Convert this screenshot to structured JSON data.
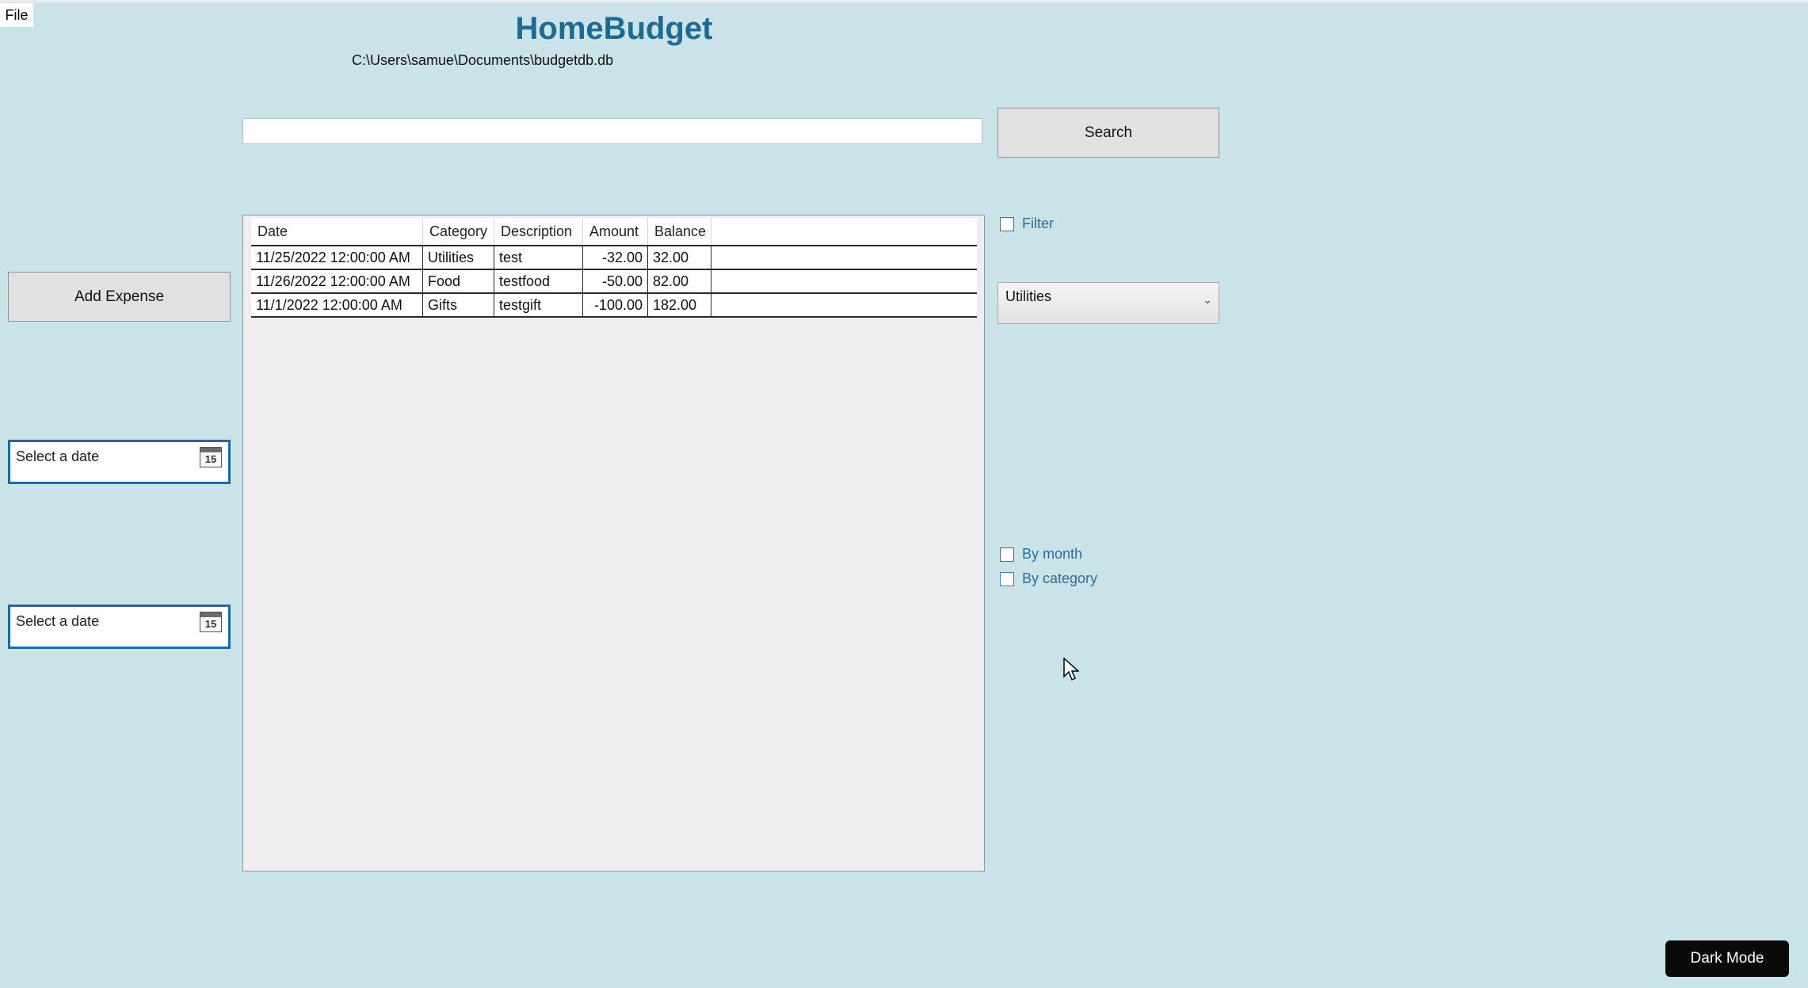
{
  "menu": {
    "file_label": "File"
  },
  "header": {
    "title": "HomeBudget",
    "db_path": "C:\\Users\\samue\\Documents\\budgetdb.db"
  },
  "search": {
    "value": "",
    "placeholder": "",
    "button_label": "Search"
  },
  "actions": {
    "add_expense_label": "Add Expense",
    "dark_mode_label": "Dark Mode"
  },
  "date_pickers": {
    "start": {
      "placeholder": "Select a date",
      "icon": "calendar-icon",
      "icon_text": "15"
    },
    "end": {
      "placeholder": "Select a date",
      "icon": "calendar-icon",
      "icon_text": "15"
    }
  },
  "grid": {
    "columns": [
      "Date",
      "Category",
      "Description",
      "Amount",
      "Balance"
    ],
    "rows": [
      {
        "date": "11/25/2022 12:00:00 AM",
        "category": "Utilities",
        "description": "test",
        "amount": "-32.00",
        "balance": "32.00"
      },
      {
        "date": "11/26/2022 12:00:00 AM",
        "category": "Food",
        "description": "testfood",
        "amount": "-50.00",
        "balance": "82.00"
      },
      {
        "date": "11/1/2022 12:00:00 AM",
        "category": "Gifts",
        "description": "testgift",
        "amount": "-100.00",
        "balance": "182.00"
      }
    ]
  },
  "filters": {
    "filter_label": "Filter",
    "filter_checked": false,
    "category_selected": "Utilities",
    "by_month_label": "By month",
    "by_month_checked": false,
    "by_category_label": "By category",
    "by_category_checked": false
  },
  "colors": {
    "background": "#cae3e8",
    "title": "#1f6a92",
    "checkbox_label": "#2a6f9a",
    "date_picker_border": "#1e6aa8",
    "dark_button": "#0a0a0a"
  }
}
